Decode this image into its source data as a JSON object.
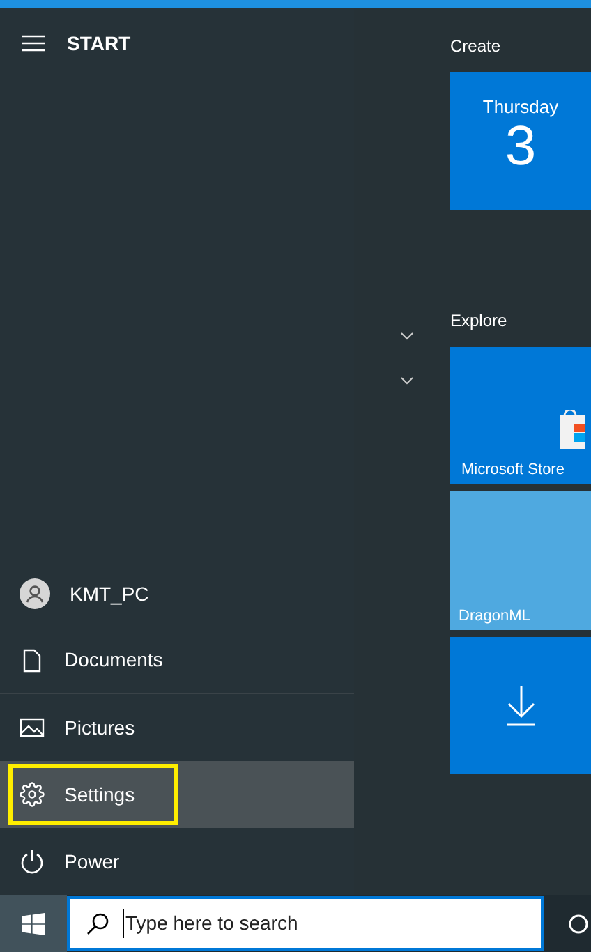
{
  "header": {
    "title": "START"
  },
  "menu_items": [
    {
      "kind": "user",
      "label": "KMT_PC",
      "selected": false
    },
    {
      "kind": "documents",
      "label": "Documents",
      "selected": false
    },
    {
      "kind": "pictures",
      "label": "Pictures",
      "selected": false
    },
    {
      "kind": "settings",
      "label": "Settings",
      "selected": true
    },
    {
      "kind": "power",
      "label": "Power",
      "selected": false
    }
  ],
  "groups": [
    {
      "title": "Create",
      "tiles": [
        {
          "kind": "calendar",
          "label": "Thursday",
          "value": "3"
        }
      ]
    },
    {
      "title": "Explore",
      "tiles": [
        {
          "kind": "store",
          "label": "Microsoft Store"
        },
        {
          "kind": "game",
          "label": "DragonML"
        },
        {
          "kind": "download"
        }
      ]
    }
  ],
  "taskbar": {
    "search": {
      "placeholder": "Type here to search"
    }
  }
}
